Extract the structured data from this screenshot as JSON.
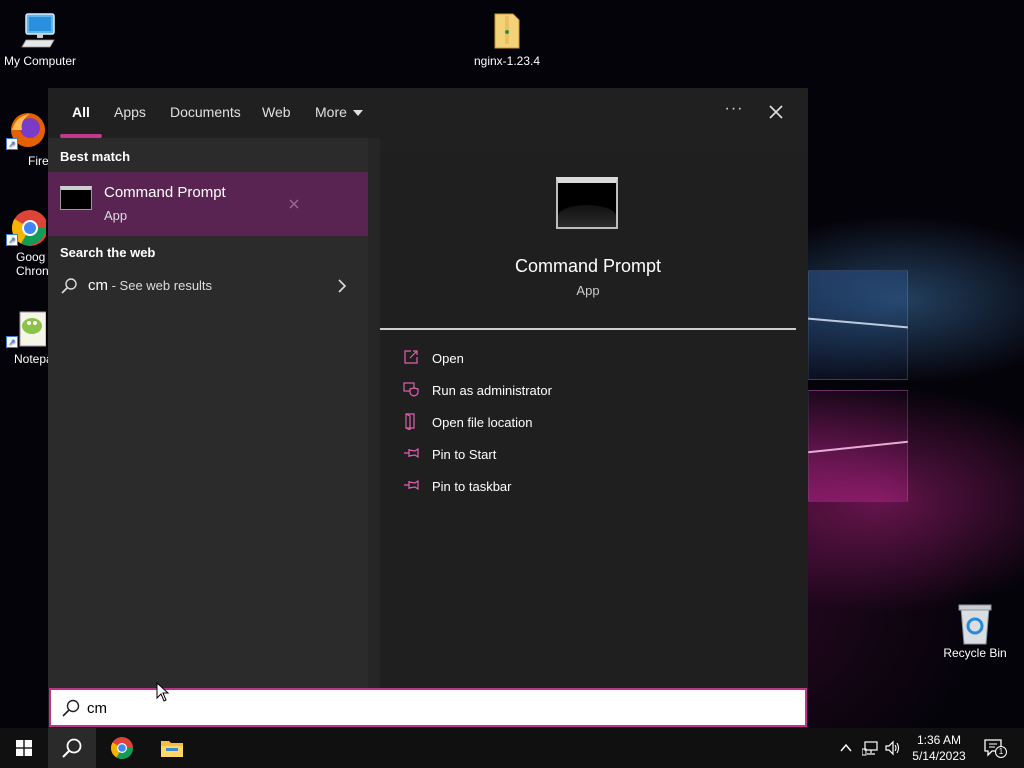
{
  "desktop": {
    "icons": [
      {
        "label": "My Computer"
      },
      {
        "label": "nginx-1.23.4"
      },
      {
        "label": "Firefo"
      },
      {
        "label": "Goog Chron"
      },
      {
        "label": "Notepa"
      },
      {
        "label": "Recycle Bin"
      }
    ]
  },
  "search_panel": {
    "tabs": [
      "All",
      "Apps",
      "Documents",
      "Web",
      "More"
    ],
    "active_tab": "All",
    "more_options_glyph": "···",
    "left": {
      "best_match_heading": "Best match",
      "best_match": {
        "title": "Command Prompt",
        "subtitle": "App"
      },
      "search_web_heading": "Search the web",
      "web_result": {
        "query": "cm",
        "suffix": " - See web results"
      }
    },
    "right": {
      "title": "Command Prompt",
      "subtitle": "App",
      "actions": [
        {
          "label": "Open",
          "icon": "open-icon"
        },
        {
          "label": "Run as administrator",
          "icon": "shield-icon"
        },
        {
          "label": "Open file location",
          "icon": "file-location-icon"
        },
        {
          "label": "Pin to Start",
          "icon": "pin-icon"
        },
        {
          "label": "Pin to taskbar",
          "icon": "pin-icon"
        }
      ]
    }
  },
  "search_box": {
    "value": "cm"
  },
  "taskbar": {
    "clock_time": "1:36 AM",
    "clock_date": "5/14/2023",
    "notification_count": "1"
  },
  "colors": {
    "accent": "#c2388a",
    "selection": "#5a2452",
    "panel_bg": "#202020",
    "left_bg": "#2b2b2b"
  }
}
